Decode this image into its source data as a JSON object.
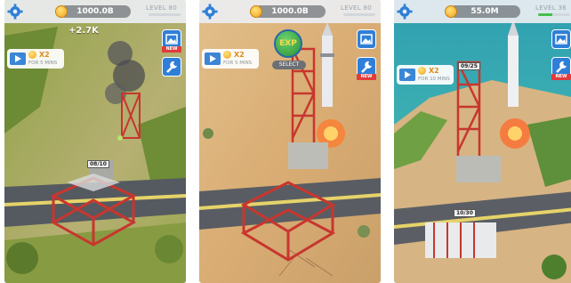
{
  "panels": [
    {
      "money": "1000.0B",
      "level": "LEVEL 80",
      "level_progress": 0.0,
      "income": "+2.7K",
      "ad": {
        "multiplier": "X2",
        "duration": "FOR 5 MINS"
      },
      "side_buttons": [
        {
          "icon": "photo-icon",
          "tag": "NEW"
        },
        {
          "icon": "wrench-icon",
          "tag": ""
        }
      ],
      "progress_label": "08/10",
      "exp": null
    },
    {
      "money": "1000.0B",
      "level": "LEVEL 80",
      "level_progress": 0.0,
      "income": "",
      "ad": {
        "multiplier": "X2",
        "duration": "FOR 5 MINS"
      },
      "side_buttons": [
        {
          "icon": "photo-icon",
          "tag": ""
        },
        {
          "icon": "wrench-icon",
          "tag": "NEW"
        }
      ],
      "progress_label": "",
      "exp": {
        "label": "EXP",
        "pill": "SELECT"
      }
    },
    {
      "money": "55.0M",
      "level": "LEVEL 36",
      "level_progress": 0.45,
      "income": "",
      "ad": {
        "multiplier": "X2",
        "duration": "FOR 10 MINS"
      },
      "side_buttons": [
        {
          "icon": "photo-icon",
          "tag": ""
        },
        {
          "icon": "wrench-icon",
          "tag": "NEW"
        }
      ],
      "progress_label": "09/25",
      "progress_label_2": "10/30",
      "exp": null
    }
  ],
  "colors": {
    "sand": "#d9b07a",
    "grass": "#9bb45a",
    "ocean": "#3fb7b4",
    "steel_red": "#c8362e",
    "ui_blue": "#2f7fd8"
  }
}
